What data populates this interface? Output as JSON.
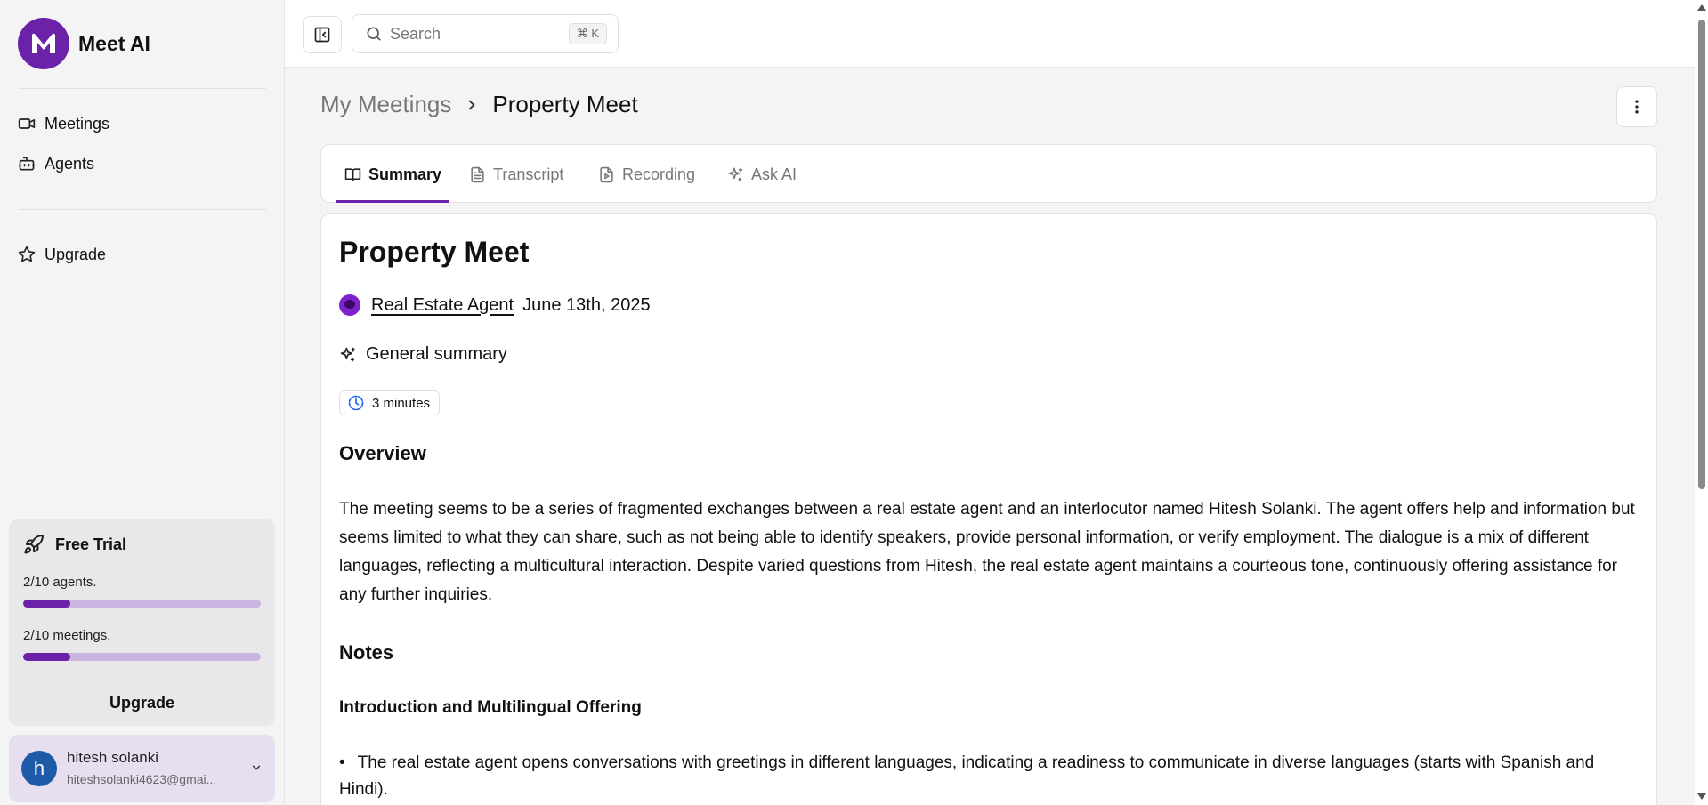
{
  "app": {
    "name": "Meet AI",
    "logo_letter": "M",
    "accent_color": "#6b21a8"
  },
  "sidebar": {
    "items": [
      {
        "label": "Meetings",
        "icon": "video-icon"
      },
      {
        "label": "Agents",
        "icon": "bot-icon"
      }
    ],
    "upgrade_item": {
      "label": "Upgrade",
      "icon": "star-icon"
    },
    "trial": {
      "title": "Free Trial",
      "agents_label": "2/10 agents.",
      "agents_used_fraction": 0.2,
      "meetings_label": "2/10 meetings.",
      "meetings_used_fraction": 0.2,
      "upgrade_label": "Upgrade"
    },
    "user": {
      "initial": "h",
      "name": "hitesh solanki",
      "email": "hiteshsolanki4623@gmai..."
    }
  },
  "topbar": {
    "search_placeholder": "Search",
    "shortcut": "⌘ K"
  },
  "breadcrumb": {
    "parent": "My Meetings",
    "current": "Property Meet"
  },
  "tabs": [
    {
      "label": "Summary",
      "icon": "book-open-icon",
      "active": true
    },
    {
      "label": "Transcript",
      "icon": "file-text-icon",
      "active": false
    },
    {
      "label": "Recording",
      "icon": "file-video-icon",
      "active": false
    },
    {
      "label": "Ask AI",
      "icon": "sparkles-icon",
      "active": false
    }
  ],
  "meeting": {
    "title": "Property Meet",
    "agent_name": "Real Estate Agent",
    "date": "June 13th, 2025",
    "summary_label": "General summary",
    "duration": "3 minutes",
    "overview_heading": "Overview",
    "overview_text": "The meeting seems to be a series of fragmented exchanges between a real estate agent and an interlocutor named Hitesh Solanki. The agent offers help and information but seems limited to what they can share, such as not being able to identify speakers, provide personal information, or verify employment. The dialogue is a mix of different languages, reflecting a multicultural interaction. Despite varied questions from Hitesh, the real estate agent maintains a courteous tone, continuously offering assistance for any further inquiries.",
    "notes_heading": "Notes",
    "notes_subheading": "Introduction and Multilingual Offering",
    "notes_bullet": "The real estate agent opens conversations with greetings in different languages, indicating a readiness to communicate in diverse languages (starts with Spanish and Hindi)."
  }
}
